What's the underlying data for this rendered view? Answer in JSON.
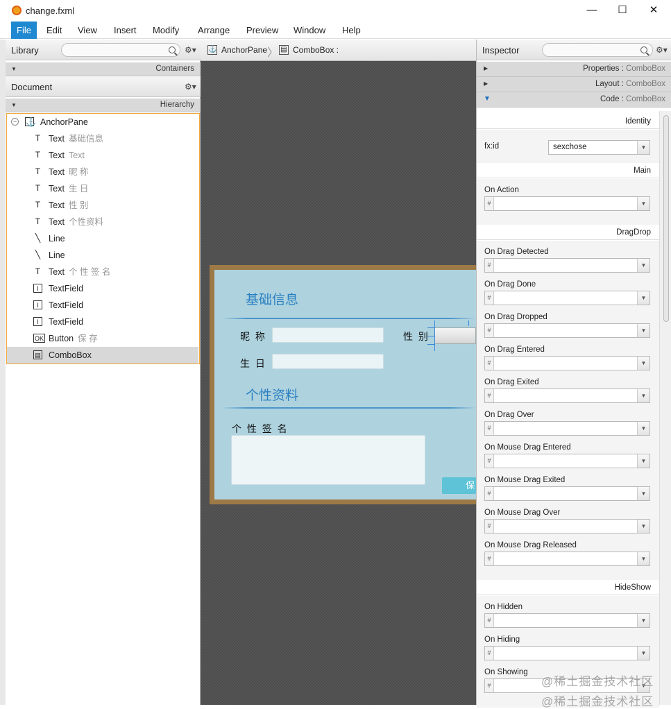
{
  "window": {
    "title": "change.fxml",
    "minimize_glyph": "—",
    "maximize_glyph": "☐",
    "close_glyph": "✕"
  },
  "menu": [
    "File",
    "Edit",
    "View",
    "Insert",
    "Modify",
    "Arrange",
    "Preview",
    "Window",
    "Help"
  ],
  "library": {
    "title": "Library",
    "section": "Containers"
  },
  "document": {
    "title": "Document",
    "section": "Hierarchy"
  },
  "hierarchy": {
    "root": "AnchorPane",
    "items": [
      {
        "type": "Text",
        "text": "基础信息",
        "icon": "T"
      },
      {
        "type": "Text",
        "text": "Text",
        "icon": "T"
      },
      {
        "type": "Text",
        "text": "昵 称",
        "icon": "T"
      },
      {
        "type": "Text",
        "text": "生 日",
        "icon": "T"
      },
      {
        "type": "Text",
        "text": "性 别",
        "icon": "T"
      },
      {
        "type": "Text",
        "text": "个性资料",
        "icon": "T"
      },
      {
        "type": "Line",
        "text": "",
        "icon": "╲"
      },
      {
        "type": "Line",
        "text": "",
        "icon": "╲"
      },
      {
        "type": "Text",
        "text": "个 性 签 名",
        "icon": "T"
      },
      {
        "type": "TextField",
        "text": "",
        "icon": "I"
      },
      {
        "type": "TextField",
        "text": "",
        "icon": "I"
      },
      {
        "type": "TextField",
        "text": "",
        "icon": "I"
      },
      {
        "type": "Button",
        "text": "保 存",
        "icon": "OK"
      },
      {
        "type": "ComboBox",
        "text": "",
        "icon": "▤"
      }
    ]
  },
  "breadcrumb": {
    "root": "AnchorPane",
    "current": "ComboBox :"
  },
  "form": {
    "section1": "基础信息",
    "nickname_label": "昵 称",
    "gender_label": "性 别",
    "birthday_label": "生 日",
    "section2": "个性资料",
    "signature_label": "个 性 签 名",
    "save_button": "保"
  },
  "inspector": {
    "title": "Inspector",
    "sections": [
      {
        "name": "Properties",
        "context": "ComboBox"
      },
      {
        "name": "Layout",
        "context": "ComboBox"
      },
      {
        "name": "Code",
        "context": "ComboBox"
      }
    ],
    "identity": {
      "header": "Identity",
      "fxid_label": "fx:id",
      "fxid_value": "sexchose"
    },
    "main": {
      "header": "Main",
      "events": [
        "On Action"
      ]
    },
    "dragdrop": {
      "header": "DragDrop",
      "events": [
        "On Drag Detected",
        "On Drag Done",
        "On Drag Dropped",
        "On Drag Entered",
        "On Drag Exited",
        "On Drag Over",
        "On Mouse Drag Entered",
        "On Mouse Drag Exited",
        "On Mouse Drag Over",
        "On Mouse Drag Released"
      ]
    },
    "hideshow": {
      "header": "HideShow",
      "events": [
        "On Hidden",
        "On Hiding",
        "On Showing"
      ]
    },
    "hash_symbol": "#"
  },
  "watermark": "@稀土掘金技术社区",
  "colors": {
    "menu_active": "#1e88d0",
    "selection_border": "#f2a83a",
    "form_bg": "#aed3df",
    "form_title": "#2b7fc0"
  }
}
